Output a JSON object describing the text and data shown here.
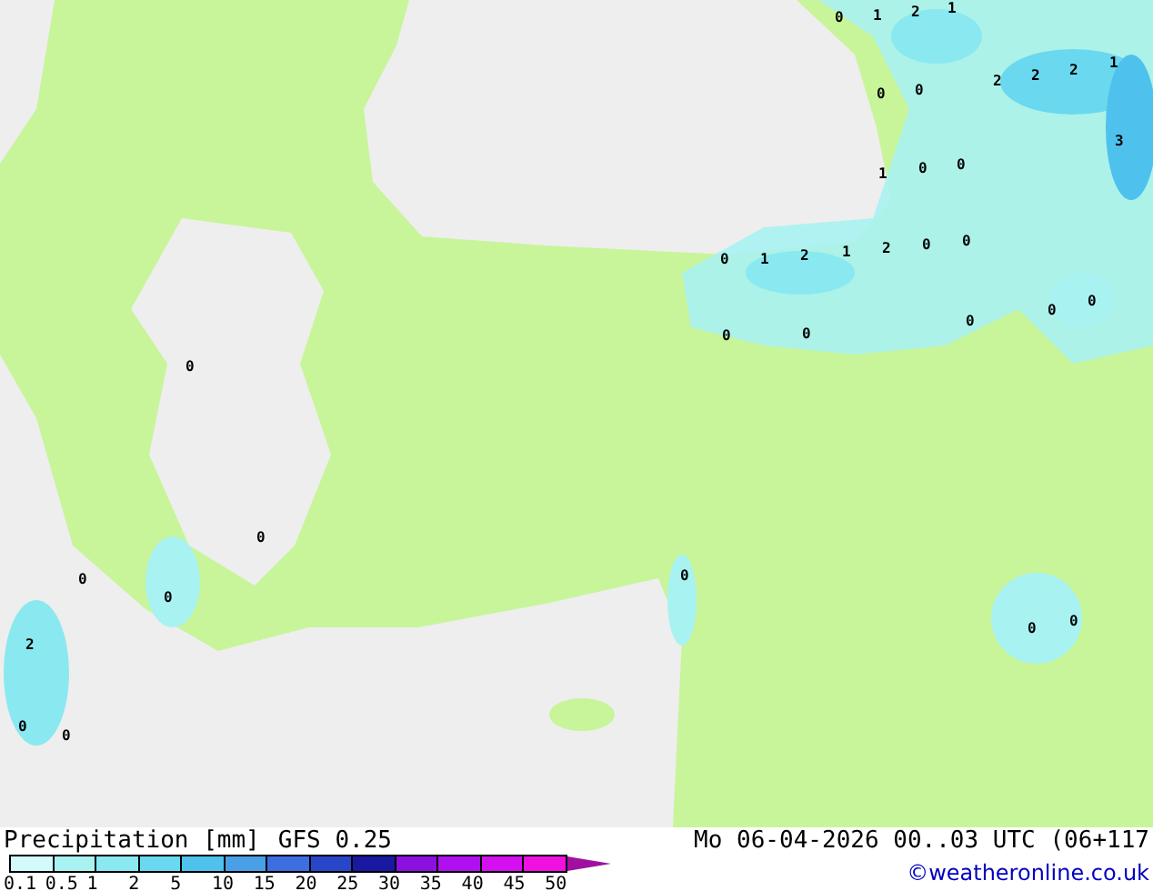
{
  "map_labels": [
    "0",
    "1",
    "2",
    "1",
    "2",
    "2",
    "2",
    "1",
    "3",
    "0",
    "0",
    "1",
    "0",
    "0",
    "0",
    "1",
    "2",
    "1",
    "2",
    "0",
    "0",
    "0",
    "0",
    "0",
    "0",
    "0",
    "0",
    "0",
    "0",
    "0",
    "2",
    "0",
    "0",
    "0",
    "0",
    "0"
  ],
  "footer": {
    "title": "Precipitation [mm]",
    "model": "GFS 0.25",
    "datetime": "Mo 06-04-2026 00..03 UTC (06+117",
    "credit": "©weatheronline.co.uk"
  },
  "legend": {
    "bins": [
      {
        "color": "#d2fafa"
      },
      {
        "color": "#a8f2f2"
      },
      {
        "color": "#8ae8f0"
      },
      {
        "color": "#6ad8ee"
      },
      {
        "color": "#4ec2ec"
      },
      {
        "color": "#4aa0e6"
      },
      {
        "color": "#3c6ee0"
      },
      {
        "color": "#2846c8"
      },
      {
        "color": "#1818a0"
      },
      {
        "color": "#8c10e0"
      },
      {
        "color": "#b010f0"
      },
      {
        "color": "#d410f0"
      },
      {
        "color": "#f010e0"
      },
      {
        "color": "#a010a0"
      }
    ],
    "ticks": [
      "0.1",
      "0.5",
      "1",
      "2",
      "5",
      "10",
      "15",
      "20",
      "25",
      "30",
      "35",
      "40",
      "45",
      "50"
    ]
  }
}
